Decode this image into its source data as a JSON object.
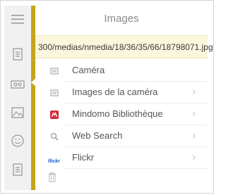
{
  "panel": {
    "title": "Images",
    "url": "300/medias/nmedia/18/36/35/66/18798071.jpg"
  },
  "sidebar": {
    "icons": [
      "hamburger-icon",
      "note-icon",
      "link-icon",
      "image-icon",
      "emoji-icon",
      "document-icon"
    ]
  },
  "menu": {
    "items": [
      {
        "label": "Caméra",
        "icon": "camera-icon",
        "chevron": false
      },
      {
        "label": "Images de la caméra",
        "icon": "camera-roll-icon",
        "chevron": true
      },
      {
        "label": "Mindomo Bibliothèque",
        "icon": "mindomo-icon",
        "chevron": true
      },
      {
        "label": "Web Search",
        "icon": "search-icon",
        "chevron": true
      },
      {
        "label": "Flickr",
        "icon": "flickr-icon",
        "brand": "flickr",
        "chevron": true
      }
    ]
  },
  "colors": {
    "accent_strip": "#c7a31a",
    "url_background": "#fbf7dc",
    "mindomo_red": "#d9283c",
    "flickr_blue": "#1a5ec6"
  }
}
